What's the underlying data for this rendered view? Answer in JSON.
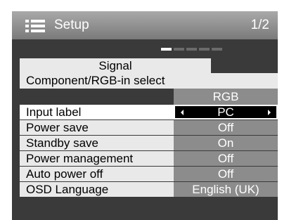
{
  "header": {
    "title": "Setup",
    "page_indicator": "1/2",
    "icon": "menu-list-icon"
  },
  "pager": {
    "pages": 5,
    "active_index": 0
  },
  "signal_tab": {
    "label": "Signal"
  },
  "component_select": {
    "label": "Component/RGB-in select",
    "value": "RGB"
  },
  "rows": [
    {
      "label": "Input label",
      "value": "PC",
      "selected": true
    },
    {
      "label": "Power save",
      "value": "Off"
    },
    {
      "label": "Standby save",
      "value": "On"
    },
    {
      "label": "Power management",
      "value": "Off"
    },
    {
      "label": "Auto power off",
      "value": "Off"
    },
    {
      "label": "OSD Language",
      "value": "English (UK)"
    }
  ],
  "colors": {
    "frame": "#3a3a3a",
    "label_bg": "#e9e9e9",
    "value_bg": "#8c8c8c",
    "selected_value_bg": "#000000"
  }
}
